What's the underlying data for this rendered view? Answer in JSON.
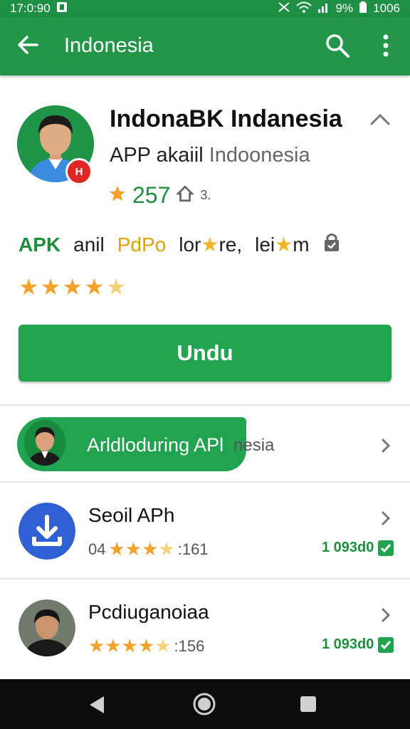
{
  "status_bar": {
    "time": "17:0:90",
    "battery_pct": "9%",
    "clock_right": "1006"
  },
  "app_bar": {
    "title": "Indonesia",
    "icons": [
      "back-arrow-icon",
      "search-icon",
      "more-vert-icon"
    ]
  },
  "app": {
    "title": "IndonaBK Indanesia",
    "subtitle_main": "APP akaiil",
    "subtitle_grey": "Indoonesia",
    "rating": "257",
    "small_count": "3.",
    "badge_text": "H"
  },
  "info_row": {
    "apk": "APK",
    "anil": "anil",
    "pdpo": "PdPo",
    "lore": "lor",
    "lore_tail": "re,",
    "lei": "lei",
    "m": "m"
  },
  "stars_rating": 4.5,
  "download_button": {
    "label": "Undu"
  },
  "promo": {
    "text": "Arldloduring APl",
    "tail": "nesia"
  },
  "list": [
    {
      "title": "Seoil APh",
      "prefix": "04",
      "rating_text": ":161",
      "size": "1 093d0",
      "icon": "download-icon"
    },
    {
      "title": "Pcdiuganoiaa",
      "prefix": "",
      "rating_text": ":156",
      "size": "1 093d0",
      "icon": "person-avatar-icon"
    }
  ],
  "colors": {
    "primary": "#23964a",
    "button": "#22a34f",
    "star": "#f2a12b",
    "badge": "#e02727",
    "blue_icon": "#2f5fd0"
  }
}
